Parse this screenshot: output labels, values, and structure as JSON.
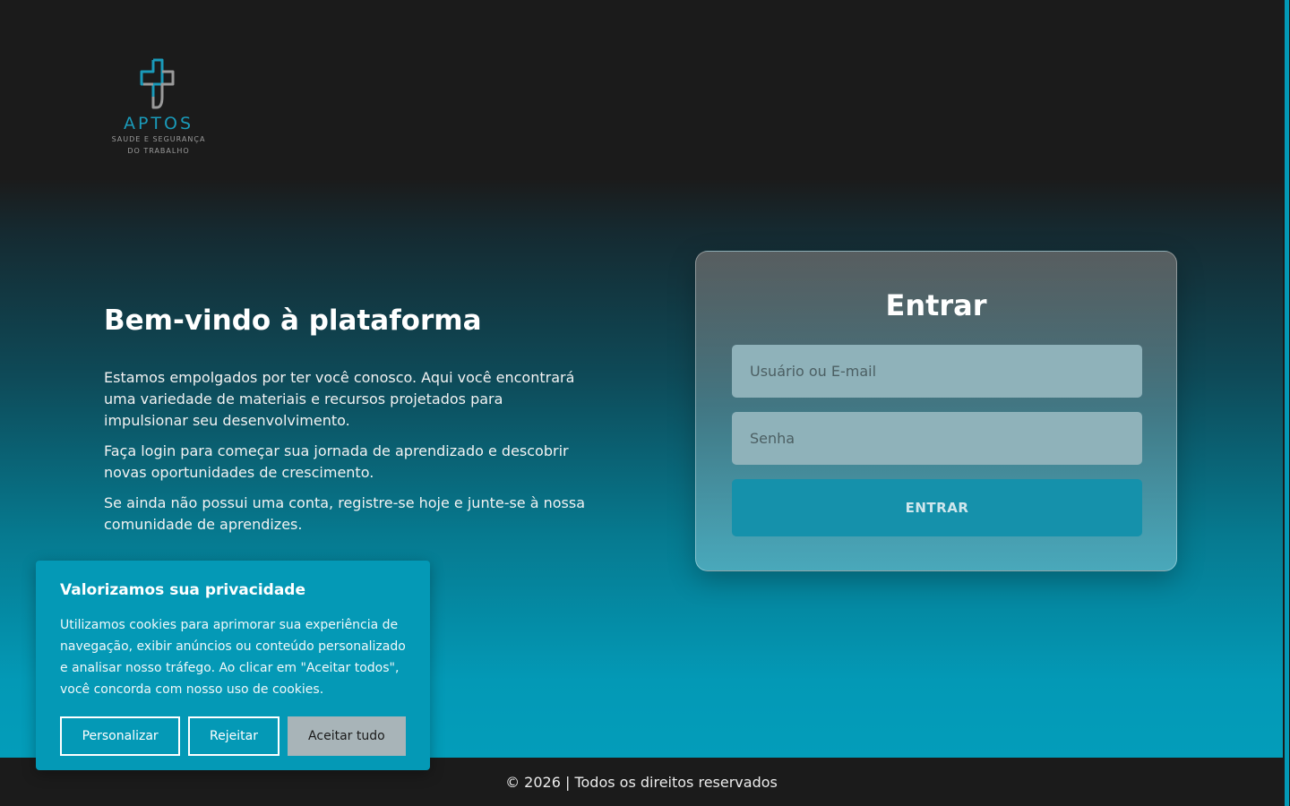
{
  "logo": {
    "name": "APTOS",
    "tagline_line1": "SAUDE E SEGURANÇA",
    "tagline_line2": "DO TRABALHO",
    "icon": "medical-cross-icon",
    "colors": {
      "teal": "#1a9ab9",
      "gray": "#9a9a9a"
    }
  },
  "welcome": {
    "title": "Bem-vindo à plataforma",
    "paragraphs": [
      "Estamos empolgados por ter você conosco. Aqui você encontrará uma variedade de materiais e recursos projetados para impulsionar seu desenvolvimento.",
      "Faça login para começar sua jornada de aprendizado e descobrir novas oportunidades de crescimento.",
      "Se ainda não possui uma conta, registre-se hoje e junte-se à nossa comunidade de aprendizes."
    ]
  },
  "login": {
    "title": "Entrar",
    "username_placeholder": "Usuário ou E-mail",
    "password_placeholder": "Senha",
    "submit_label": "ENTRAR"
  },
  "cookie_banner": {
    "title": "Valorizamos sua privacidade",
    "text": "Utilizamos cookies para aprimorar sua experiência de navegação, exibir anúncios ou conteúdo personalizado e analisar nosso tráfego. Ao clicar em \"Aceitar todos\", você concorda com nosso uso de cookies.",
    "customize_label": "Personalizar",
    "reject_label": "Rejeitar",
    "accept_label": "Aceitar tudo"
  },
  "footer": {
    "copyright_symbol": "©",
    "text": "2026 | Todos os direitos reservados"
  },
  "colors": {
    "accent": "#0399b6",
    "dark": "#1b1b1b",
    "button": "#1591ab"
  }
}
